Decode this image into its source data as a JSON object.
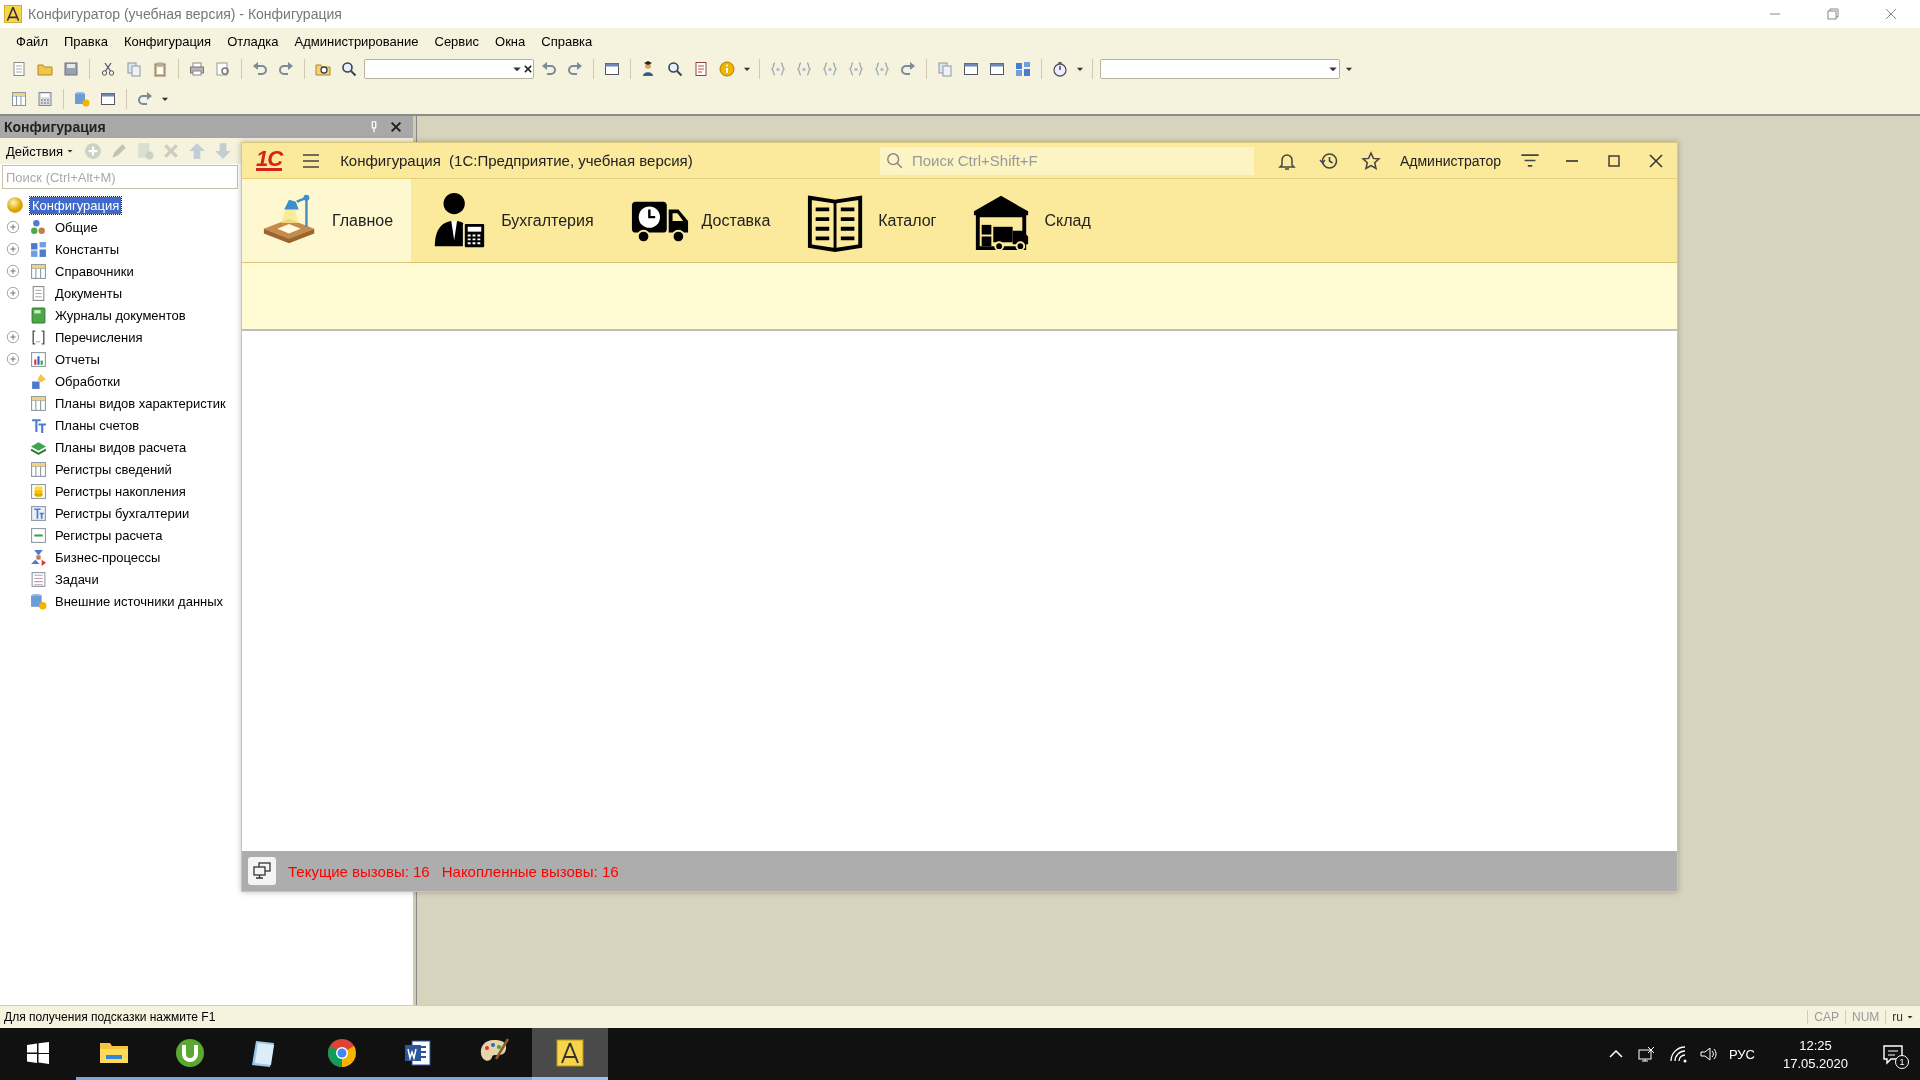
{
  "window": {
    "title": "Конфигуратор (учебная версия) - Конфигурация"
  },
  "menu": [
    "Файл",
    "Правка",
    "Конфигурация",
    "Отладка",
    "Администрирование",
    "Сервис",
    "Окна",
    "Справка"
  ],
  "config_panel": {
    "title": "Конфигурация",
    "actions_label": "Действия",
    "search": {
      "placeholder": "Поиск (Ctrl+Alt+M)"
    },
    "tree": {
      "label": "Конфигурация",
      "selected": true,
      "children": [
        {
          "label": "Общие",
          "has_children": true,
          "selected": false
        },
        {
          "label": "Константы",
          "has_children": true,
          "selected": false
        },
        {
          "label": "Справочники",
          "has_children": true,
          "selected": false
        },
        {
          "label": "Документы",
          "has_children": true,
          "selected": false
        },
        {
          "label": "Журналы документов",
          "has_children": false,
          "selected": false
        },
        {
          "label": "Перечисления",
          "has_children": true,
          "selected": false
        },
        {
          "label": "Отчеты",
          "has_children": true,
          "selected": false
        },
        {
          "label": "Обработки",
          "has_children": false,
          "selected": false
        },
        {
          "label": "Планы видов характеристик",
          "has_children": false,
          "selected": false
        },
        {
          "label": "Планы счетов",
          "has_children": false,
          "selected": false
        },
        {
          "label": "Планы видов расчета",
          "has_children": false,
          "selected": false
        },
        {
          "label": "Регистры сведений",
          "has_children": false,
          "selected": false
        },
        {
          "label": "Регистры накопления",
          "has_children": false,
          "selected": false
        },
        {
          "label": "Регистры бухгалтерии",
          "has_children": false,
          "selected": false
        },
        {
          "label": "Регистры расчета",
          "has_children": false,
          "selected": false
        },
        {
          "label": "Бизнес-процессы",
          "has_children": false,
          "selected": false
        },
        {
          "label": "Задачи",
          "has_children": false,
          "selected": false
        },
        {
          "label": "Внешние источники данных",
          "has_children": false,
          "selected": false
        }
      ]
    }
  },
  "app_window": {
    "logo": "1С",
    "title": "Конфигурация  (1С:Предприятие, учебная версия)",
    "search": {
      "placeholder": "Поиск Ctrl+Shift+F"
    },
    "user": "Администратор",
    "sections": [
      {
        "label": "Главное",
        "selected": true
      },
      {
        "label": "Бухгалтерия",
        "selected": false
      },
      {
        "label": "Доставка",
        "selected": false
      },
      {
        "label": "Каталог",
        "selected": false
      },
      {
        "label": "Склад",
        "selected": false
      }
    ],
    "status": [
      "Текущие вызовы: 16",
      "Накопленные вызовы: 16"
    ]
  },
  "status_bar": {
    "hint": "Для получения подсказки нажмите F1",
    "indicators": [
      "CAP",
      "NUM",
      "ru"
    ]
  },
  "taskbar": {
    "apps": [
      {
        "selected": false
      },
      {
        "selected": false
      },
      {
        "selected": false
      },
      {
        "selected": false
      },
      {
        "selected": false
      },
      {
        "selected": false
      },
      {
        "selected": true
      }
    ],
    "tray": {
      "language": "РУС",
      "time": "12:25",
      "date": "17.05.2020",
      "notifications": "1"
    }
  }
}
